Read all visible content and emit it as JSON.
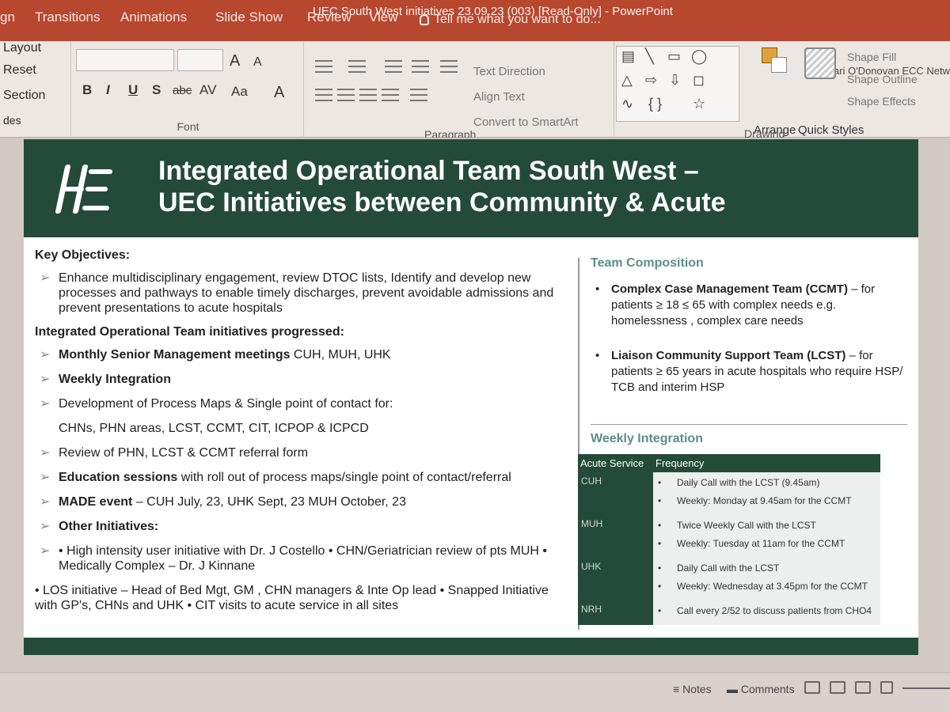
{
  "window": {
    "title": "UEC South West initiatives 23.09.23 (003) [Read-Only] - PowerPoint",
    "user": "Mari O'Donovan ECC Netw"
  },
  "tabs": [
    "gn",
    "Transitions",
    "Animations",
    "Slide Show",
    "Review",
    "View"
  ],
  "tell_me": "Tell me what you want to do...",
  "ribbon": {
    "slides_group": [
      "Layout",
      "Reset",
      "Section",
      "des"
    ],
    "font_label": "Font",
    "paragraph_label": "Paragraph",
    "drawing_label": "Drawing",
    "font_buttons": [
      "B",
      "I",
      "U",
      "S",
      "abc",
      "AV",
      "Aa",
      "A"
    ],
    "grow_font": "A",
    "shrink_font": "A",
    "text_direction": "Text Direction",
    "align_text": "Align Text",
    "convert_smartart": "Convert to SmartArt",
    "arrange": "Arrange",
    "quick_styles": "Quick Styles",
    "shape_fill": "Shape Fill",
    "shape_outline": "Shape Outline",
    "shape_effects": "Shape Effects"
  },
  "slide": {
    "title_line1": "Integrated Operational Team South West –",
    "title_line2": "UEC Initiatives between Community & Acute",
    "key_objectives_heading": "Key Objectives:",
    "key_objective": "Enhance multidisciplinary engagement, review DTOC lists, Identify and develop new processes and pathways to enable timely discharges, prevent avoidable admissions and prevent presentations to acute hospitals",
    "progressed_heading": "Integrated Operational Team initiatives progressed:",
    "initiatives": [
      {
        "bold": "Monthly Senior Management meetings",
        "rest": " CUH, MUH, UHK"
      },
      {
        "bold": "Weekly Integration",
        "rest": ""
      },
      {
        "bold": "",
        "rest": "Development of Process Maps & Single point of contact for:"
      },
      {
        "bold": "",
        "rest": "CHNs, PHN areas, LCST, CCMT, CIT, ICPOP & ICPCD"
      },
      {
        "bold": "",
        "rest": "Review of PHN, LCST & CCMT referral form"
      },
      {
        "bold": "Education sessions",
        "rest": " with roll out of process maps/single point of contact/referral"
      },
      {
        "bold": "MADE event",
        "rest": " – CUH July, 23, UHK Sept, 23 MUH October, 23"
      },
      {
        "bold": "Other Initiatives:",
        "rest": ""
      }
    ],
    "other_initiatives_1": "• High intensity user initiative with Dr. J Costello     • CHN/Geriatrician review of pts MUH  • Medically Complex – Dr. J Kinnane",
    "other_initiatives_2": "• LOS initiative – Head of Bed Mgt, GM , CHN managers & Inte Op lead  • Snapped Initiative with GP's, CHNs and UHK  • CIT visits to acute service in all sites",
    "team_heading": "Team Composition",
    "team": [
      {
        "bold": "Complex Case Management Team (CCMT)",
        "rest": " – for patients ≥ 18 ≤ 65 with complex needs e.g. homelessness , complex care needs"
      },
      {
        "bold": "Liaison Community Support Team (LCST)",
        "rest": " – for patients ≥ 65 years in acute hospitals who require HSP/ TCB and interim HSP"
      }
    ],
    "weekly_heading": "Weekly Integration",
    "table": {
      "headers": [
        "Acute Service",
        "Frequency"
      ],
      "rows": [
        {
          "service": "CUH",
          "items": [
            "Daily Call with the LCST (9.45am)",
            "Weekly: Monday at 9.45am for the CCMT"
          ]
        },
        {
          "service": "MUH",
          "items": [
            "Twice Weekly Call with the LCST",
            "Weekly: Tuesday at 11am for the CCMT"
          ]
        },
        {
          "service": "UHK",
          "items": [
            "Daily Call with the LCST",
            "Weekly: Wednesday at 3.45pm for the CCMT"
          ]
        },
        {
          "service": "NRH",
          "items": [
            "Call every 2/52 to discuss patients from CHO4"
          ]
        }
      ]
    }
  },
  "statusbar": {
    "notes": "Notes",
    "comments": "Comments"
  },
  "colors": {
    "ribbon_red": "#b8472f",
    "hse_green": "#244b3a",
    "teal_heading": "#5a8e89"
  }
}
